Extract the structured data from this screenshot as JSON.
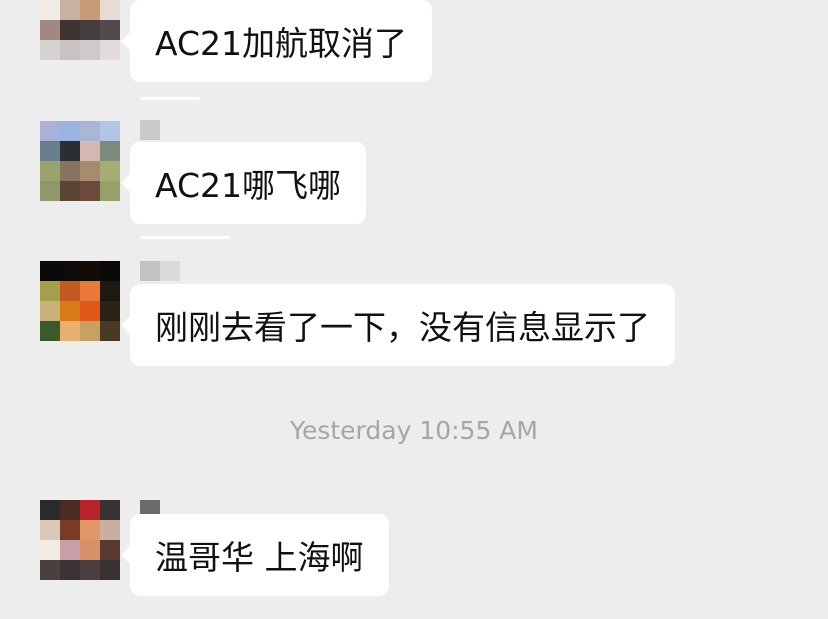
{
  "messages": [
    {
      "text": "AC21加航取消了",
      "avatar_colors": [
        "#b9b3b3",
        "#6e2a1f",
        "#c2a18e",
        "#e4dfdb",
        "#f1ebe5",
        "#c9b1a0",
        "#c79b73",
        "#e7dcd3",
        "#a28880",
        "#3e3533",
        "#463d3f",
        "#524a4c",
        "#d6d2d1",
        "#c9c3c2",
        "#cfcac8",
        "#e1dcda"
      ]
    },
    {
      "text": "AC21哪飞哪",
      "avatar_colors": [
        "#a8b2d8",
        "#9ab3e0",
        "#a9b6d4",
        "#b2c5e3",
        "#6a7f8c",
        "#2a2f33",
        "#d6b8b0",
        "#7d8b7e",
        "#9aa36b",
        "#8a7260",
        "#a58c6e",
        "#a7ad72",
        "#8e9868",
        "#5a4636",
        "#6a4a3a",
        "#98a06a"
      ],
      "nickname_colors": [
        "#c9c9c9",
        "#ededed"
      ]
    },
    {
      "text": "刚刚去看了一下，没有信息显示了",
      "avatar_colors": [
        "#0a0a0a",
        "#0d0a08",
        "#120c08",
        "#0b0907",
        "#a4a04a",
        "#c25a20",
        "#e87a3a",
        "#1c1a10",
        "#c9b27a",
        "#d87a18",
        "#e0581a",
        "#2a2416",
        "#3a5a2a",
        "#e8b070",
        "#c8a060",
        "#4a3a22"
      ],
      "nickname_colors": [
        "#c2c2c2",
        "#dadada"
      ]
    },
    {
      "text": "温哥华 上海啊",
      "avatar_colors": [
        "#2b2a2a",
        "#4a2a22",
        "#b8222a",
        "#3a3232",
        "#d8c8b8",
        "#7a3a28",
        "#e09868",
        "#c8b0a0",
        "#f4ece4",
        "#c8a0a8",
        "#d8906a",
        "#5a3a30",
        "#4a4040",
        "#3a3434",
        "#4a3e3e",
        "#3a3232"
      ],
      "nickname_colors": [
        "#6a6a6a",
        "#ededed"
      ]
    }
  ],
  "timestamp": "Yesterday 10:55 AM"
}
